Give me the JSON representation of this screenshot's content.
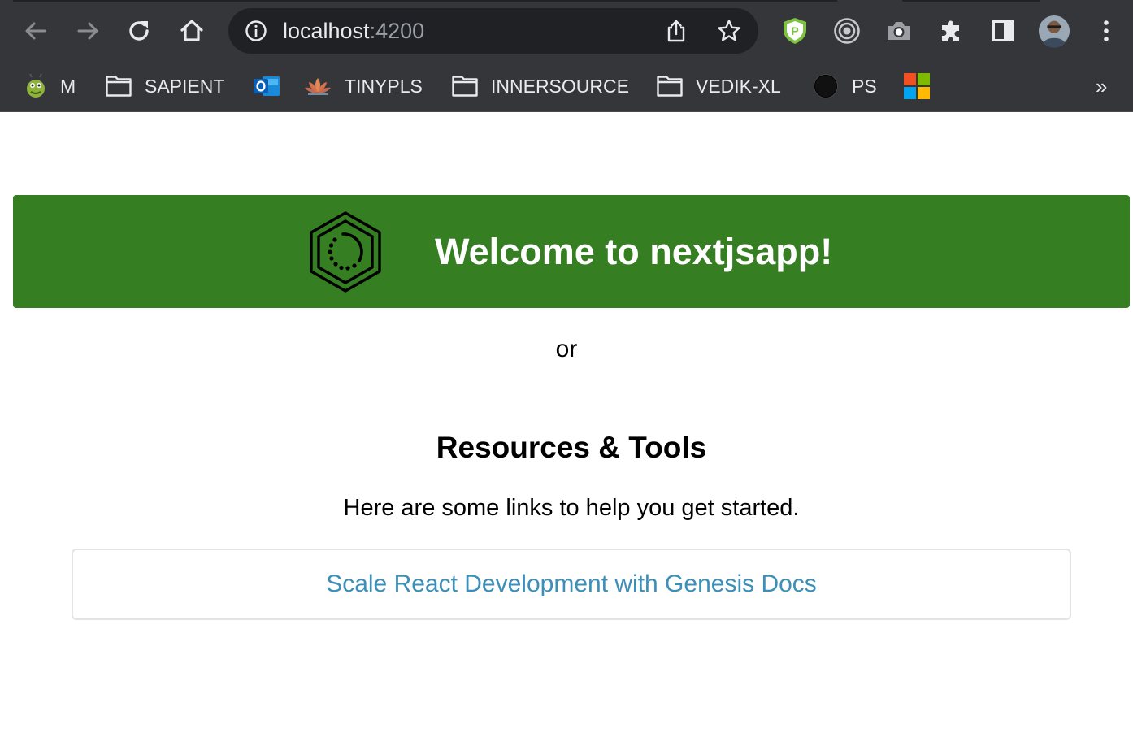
{
  "browser": {
    "nav": {
      "back_icon": "arrow-left-icon",
      "forward_icon": "arrow-right-icon",
      "reload_icon": "reload-icon",
      "home_icon": "home-icon"
    },
    "omnibox": {
      "host": "localhost",
      "port": ":4200",
      "info_icon": "info-circle-icon",
      "share_icon": "share-icon",
      "bookmark_icon": "star-icon"
    },
    "extensions": [
      "purevpn-shield-icon",
      "target-icon",
      "camera-icon",
      "puzzle-piece-icon",
      "side-panel-icon",
      "profile-avatar",
      "kebab-menu-icon"
    ],
    "colors": {
      "toolbar": "#35363a",
      "omnibox": "#202124",
      "text": "#e8eaed",
      "muted": "#9aa0a6"
    }
  },
  "bookmarks": {
    "items": [
      {
        "label": "M",
        "icon": "bug-icon"
      },
      {
        "label": "SAPIENT",
        "icon": "folder-icon"
      },
      {
        "label": "",
        "icon": "outlook-icon"
      },
      {
        "label": "TINYPLS",
        "icon": "lotus-icon"
      },
      {
        "label": "INNERSOURCE",
        "icon": "folder-icon"
      },
      {
        "label": "VEDIK-XL",
        "icon": "folder-icon"
      },
      {
        "label": "PS",
        "icon": "circle-icon"
      },
      {
        "label": "",
        "icon": "microsoft-icon"
      }
    ],
    "more": "»"
  },
  "page": {
    "banner": {
      "title": "Welcome to nextjsapp!",
      "logo_icon": "nx-hexagon-icon",
      "background": "#357e22"
    },
    "or_text": "or",
    "resources": {
      "title": "Resources & Tools",
      "subtitle": "Here are some links to help you get started."
    },
    "links": [
      {
        "label": "Scale React Development with Genesis Docs",
        "color": "#3c8fb9"
      }
    ]
  }
}
